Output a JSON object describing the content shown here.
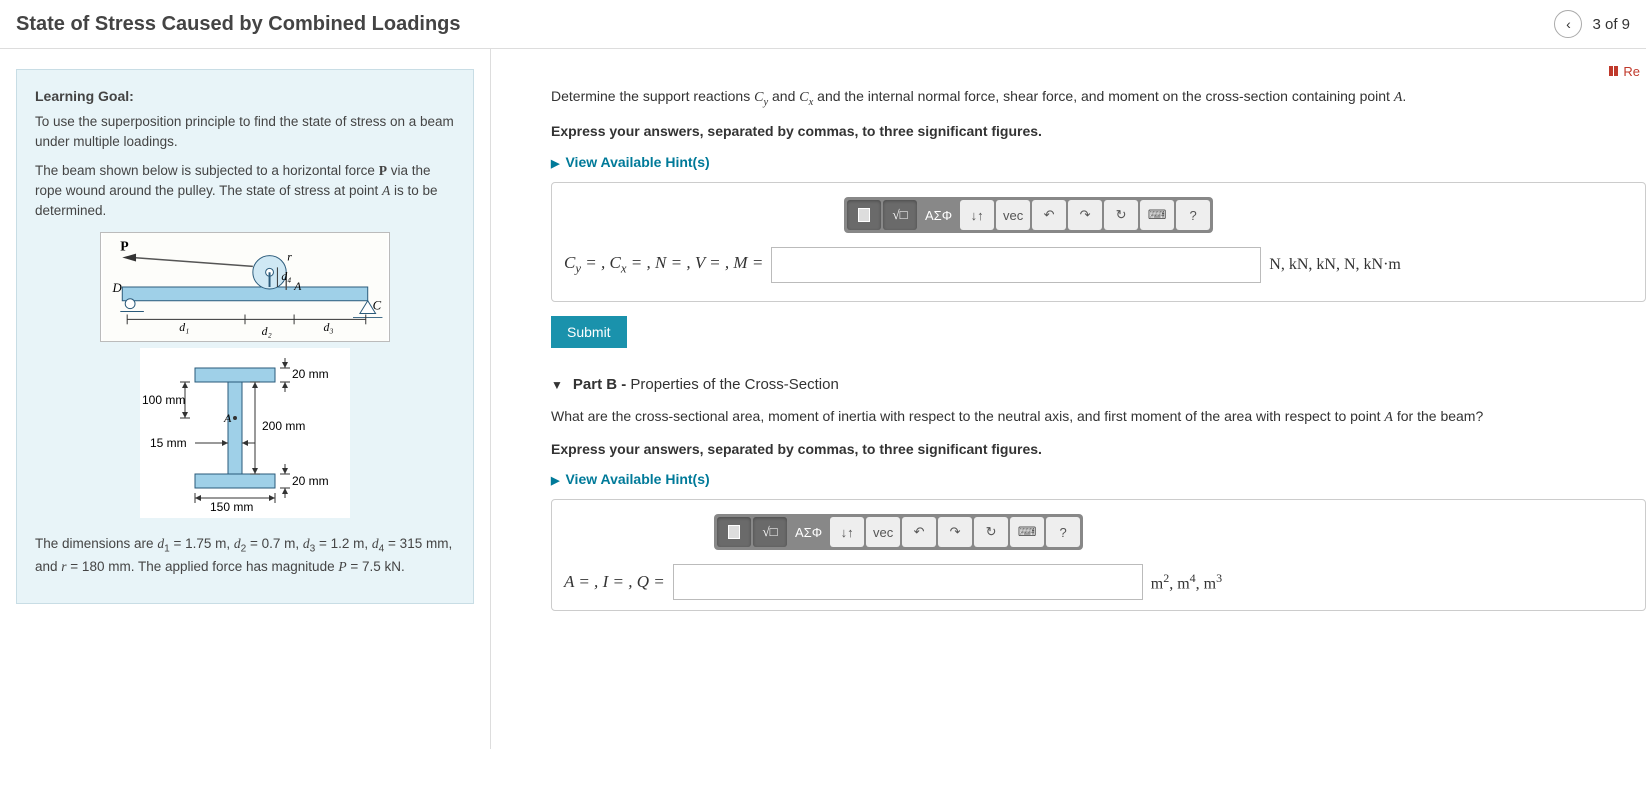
{
  "header": {
    "title": "State of Stress Caused by Combined Loadings",
    "page_indicator": "3 of 9"
  },
  "top_link": {
    "label": "Re"
  },
  "learning_goal": {
    "heading": "Learning Goal:",
    "para1": "To use the superposition principle to find the state of stress on a beam under multiple loadings.",
    "para2_prefix": "The beam shown below is subjected to a horizontal force ",
    "para2_mid": " via the rope wound around the pulley. The state of stress at point ",
    "para2_suffix": " is to be determined."
  },
  "figure": {
    "P": "P",
    "r": "r",
    "A": "A",
    "D": "D",
    "C": "C",
    "d1": "d₁",
    "d2": "d₂",
    "d3": "d₃",
    "d4": "d₄",
    "dim_20a": "20 mm",
    "dim_100": "100 mm",
    "dim_200": "200 mm",
    "dim_15": "15 mm",
    "dim_20b": "20 mm",
    "dim_150": "150 mm"
  },
  "dimensions_text": {
    "line": "The dimensions are d₁ = 1.75 m, d₂ = 0.7 m, d₃ = 1.2 m, d₄ = 315 mm, and r = 180 mm. The applied force has magnitude P = 7.5 kN."
  },
  "partA": {
    "prompt_prefix": "Determine the support reactions ",
    "prompt_mid": " and ",
    "prompt_mid2": " and the internal normal force, shear force, and moment on the cross-section containing point ",
    "prompt_suffix": ".",
    "instruction": "Express your answers, separated by commas, to three significant figures.",
    "hints": "View Available Hint(s)",
    "answer_label_html": "Cᵧ = , Cₓ = , N = , V = , M =",
    "units": "N, kN, kN, N, kN·m",
    "submit": "Submit"
  },
  "partB": {
    "header_bold": "Part B -",
    "header_rest": " Properties of the Cross-Section",
    "prompt_prefix": "What are the cross-sectional area, moment of inertia with respect to the neutral axis, and first moment of the area with respect to point ",
    "prompt_suffix": " for the beam?",
    "instruction": "Express your answers, separated by commas, to three significant figures.",
    "hints": "View Available Hint(s)",
    "answer_label": "A = , I = , Q =",
    "units": "m², m⁴, m³"
  },
  "toolbar": {
    "template": "template",
    "frac": "frac",
    "greek": "ΑΣΦ",
    "sub": "↓↑",
    "vec": "vec",
    "undo": "↶",
    "redo": "↷",
    "reset": "↻",
    "keyboard": "⌨",
    "help": "?"
  }
}
